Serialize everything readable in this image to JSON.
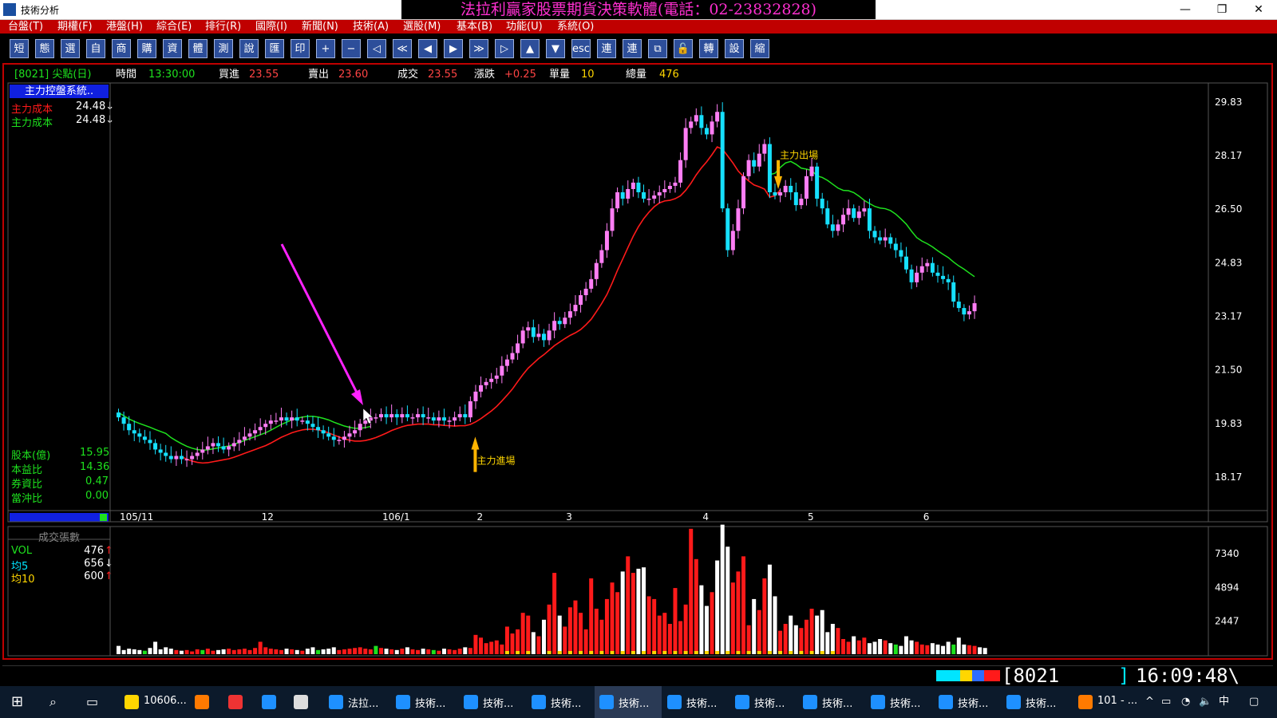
{
  "window": {
    "app_title": "技術分析",
    "banner": "法拉利贏家股票期貨決策軟體(電話：02-23832828)",
    "minimize": "—",
    "restore": "❐",
    "close": "✕"
  },
  "menu": [
    "台盤(T)",
    "期權(F)",
    "港盤(H)",
    "綜合(E)",
    "排行(R)",
    "國際(I)",
    "新聞(N)",
    "技術(A)",
    "選股(M)",
    "基本(B)",
    "功能(U)",
    "系統(O)"
  ],
  "toolbar": [
    "短",
    "態",
    "選",
    "自",
    "商",
    "購",
    "資",
    "體",
    "測",
    "說",
    "匯",
    "印",
    "+",
    "−",
    "◁",
    "≪",
    "◀",
    "▶",
    "≫",
    "▷",
    "▲",
    "▼",
    "esc",
    "連",
    "連",
    "⧉",
    "🔓",
    "轉",
    "設",
    "縮"
  ],
  "quote": {
    "code": "[8021] 尖點(日)",
    "time_label": "時間",
    "time": "13:30:00",
    "bid_label": "買進",
    "bid": "23.55",
    "ask_label": "賣出",
    "ask": "23.60",
    "trade_label": "成交",
    "trade": "23.55",
    "change_label": "漲跌",
    "change": "+0.25",
    "vol_label": "單量",
    "vol": "10",
    "total_label": "總量",
    "total": "476"
  },
  "left_panel": {
    "title": "主力控盤系統..",
    "cost_items": [
      {
        "label": "主力成本",
        "value": "24.48↓"
      },
      {
        "label": "主力成本",
        "value": "24.48↓"
      }
    ],
    "fundamentals": [
      {
        "label": "股本(億)",
        "value": "15.95"
      },
      {
        "label": "本益比",
        "value": "14.36"
      },
      {
        "label": "券資比",
        "value": "0.47"
      },
      {
        "label": "當沖比",
        "value": "0.00"
      }
    ],
    "vol_title": "成交張數",
    "vol_items": [
      {
        "label": "VOL",
        "value": "476",
        "arrow": "↑"
      },
      {
        "label": "均5",
        "value": "656",
        "arrow": "↓"
      },
      {
        "label": "均10",
        "value": "600",
        "arrow": "↑"
      }
    ]
  },
  "chart_data": [
    {
      "type": "candlestick",
      "ylim": [
        17.2,
        30.3
      ],
      "y_ticks": [
        "29.83",
        "28.17",
        "26.50",
        "24.83",
        "23.17",
        "21.50",
        "19.83",
        "18.17"
      ],
      "x_labels": [
        "105/11",
        "12",
        "106/1",
        "2",
        "3",
        "4",
        "5",
        "6"
      ],
      "x_label_index": [
        0,
        27,
        50,
        68,
        85,
        111,
        131,
        153
      ],
      "closes": [
        20.0,
        19.8,
        19.6,
        19.5,
        19.4,
        19.3,
        19.2,
        19.0,
        18.9,
        18.8,
        18.7,
        18.8,
        18.7,
        18.7,
        18.8,
        18.9,
        19.0,
        19.1,
        19.2,
        19.1,
        19.0,
        19.1,
        19.2,
        19.3,
        19.4,
        19.5,
        19.6,
        19.7,
        19.8,
        19.9,
        19.9,
        20.0,
        19.9,
        20.0,
        19.9,
        19.9,
        19.8,
        19.7,
        19.6,
        19.5,
        19.4,
        19.3,
        19.3,
        19.4,
        19.5,
        19.6,
        19.8,
        19.9,
        20.0,
        20.0,
        20.1,
        20.0,
        20.1,
        20.0,
        20.1,
        20.0,
        20.0,
        20.1,
        20.0,
        20.0,
        19.9,
        20.0,
        19.9,
        19.9,
        20.0,
        20.1,
        20.0,
        20.5,
        20.8,
        21.0,
        21.1,
        21.2,
        21.3,
        21.6,
        21.8,
        22.0,
        22.3,
        22.7,
        22.8,
        22.5,
        22.6,
        22.4,
        22.7,
        23.0,
        22.9,
        23.1,
        23.3,
        23.5,
        23.8,
        24.0,
        24.3,
        24.8,
        25.2,
        25.8,
        26.5,
        27.0,
        26.8,
        27.1,
        27.3,
        27.0,
        26.8,
        26.8,
        26.9,
        27.0,
        27.1,
        27.2,
        27.3,
        28.0,
        29.0,
        29.2,
        29.4,
        29.0,
        28.8,
        29.2,
        29.5,
        26.5,
        25.2,
        25.8,
        26.5,
        27.5,
        28.0,
        27.8,
        28.2,
        28.5,
        27.0,
        26.9,
        27.0,
        27.2,
        27.0,
        26.6,
        26.8,
        27.5,
        27.8,
        26.8,
        26.5,
        26.0,
        25.8,
        26.0,
        26.3,
        26.5,
        26.2,
        26.4,
        26.5,
        25.8,
        25.6,
        25.5,
        25.6,
        25.4,
        25.2,
        25.0,
        24.6,
        24.2,
        24.5,
        24.7,
        24.8,
        24.5,
        24.4,
        24.3,
        24.2,
        23.6,
        23.4,
        23.2,
        23.3,
        23.55
      ],
      "cost_line_start": 49,
      "entry_label": "主力進場",
      "entry_index": 68,
      "exit_label": "主力出場",
      "exit_index": 126,
      "date_stub": "",
      "series": [
        {
          "color": "#ff1a1a",
          "kind": "cost"
        },
        {
          "color": "#1ee11e",
          "kind": "ma"
        }
      ]
    },
    {
      "type": "bar",
      "ylim": [
        0,
        8800
      ],
      "y_ticks": [
        "7340",
        "4894",
        "2447"
      ],
      "values": [
        600,
        300,
        400,
        350,
        300,
        250,
        450,
        900,
        350,
        500,
        400,
        300,
        250,
        300,
        200,
        350,
        300,
        400,
        250,
        300,
        350,
        400,
        300,
        350,
        400,
        300,
        450,
        900,
        500,
        400,
        350,
        300,
        400,
        350,
        300,
        250,
        400,
        500,
        300,
        350,
        400,
        500,
        300,
        350,
        400,
        450,
        500,
        400,
        350,
        600,
        450,
        400,
        350,
        300,
        400,
        500,
        350,
        300,
        400,
        350,
        300,
        250,
        400,
        350,
        300,
        400,
        500,
        450,
        1400,
        1200,
        800,
        900,
        1000,
        700,
        2000,
        1500,
        1800,
        3000,
        2800,
        1600,
        1300,
        2500,
        3600,
        5900,
        2800,
        2000,
        3400,
        3900,
        3000,
        1800,
        5500,
        3300,
        2500,
        4000,
        5200,
        4500,
        6000,
        7100,
        5900,
        6200,
        6300,
        4200,
        4000,
        2800,
        3000,
        2200,
        4800,
        2400,
        3600,
        9100,
        6900,
        5000,
        3500,
        4500,
        6800,
        9400,
        7800,
        5200,
        6000,
        7100,
        2100,
        4000,
        3200,
        5500,
        6500,
        4200,
        1700,
        2200,
        2800,
        2100,
        1900,
        2500,
        3300,
        2800,
        3200,
        1600,
        2200,
        1900,
        1100,
        900,
        1300,
        1000,
        1200,
        800,
        900,
        1100,
        1000,
        800,
        700,
        600,
        1300,
        1000,
        900,
        700,
        650,
        800,
        700,
        600,
        900,
        700,
        1200,
        700,
        650,
        600,
        500,
        450
      ]
    }
  ],
  "status": {
    "code": "[8021",
    "bracket": "]",
    "clock": "16:09:48\\"
  },
  "taskbar": {
    "items": [
      "10606...",
      "",
      "",
      "",
      "",
      "法拉...",
      "技術...",
      "技術...",
      "技術...",
      "技術...",
      "技術...",
      "技術...",
      "技術...",
      "技術...",
      "技術...",
      "技術...",
      "101 - ..."
    ],
    "tray": [
      "^",
      "▭",
      "◔",
      "🔈",
      "中",
      "▢"
    ]
  }
}
